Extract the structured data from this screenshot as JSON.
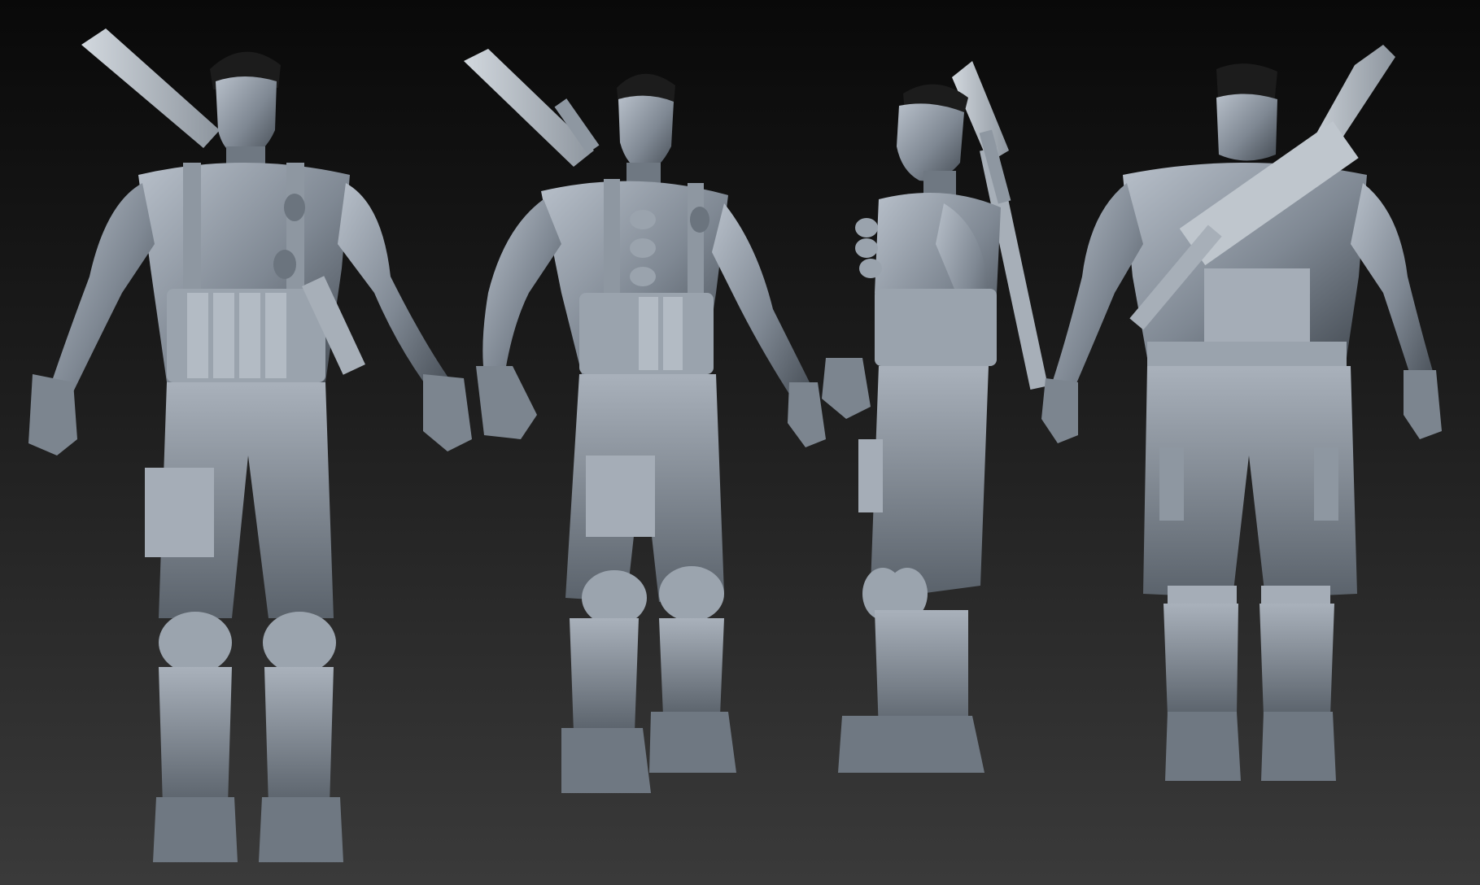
{
  "scene": {
    "description_visible_text": "",
    "palette": {
      "background_top": "#090909",
      "background_bottom": "#3a3a3a",
      "clay_light": "#b4bcc6",
      "clay_mid": "#7e8792",
      "clay_dark": "#3f464e",
      "hair": "#1c1c1c"
    }
  }
}
